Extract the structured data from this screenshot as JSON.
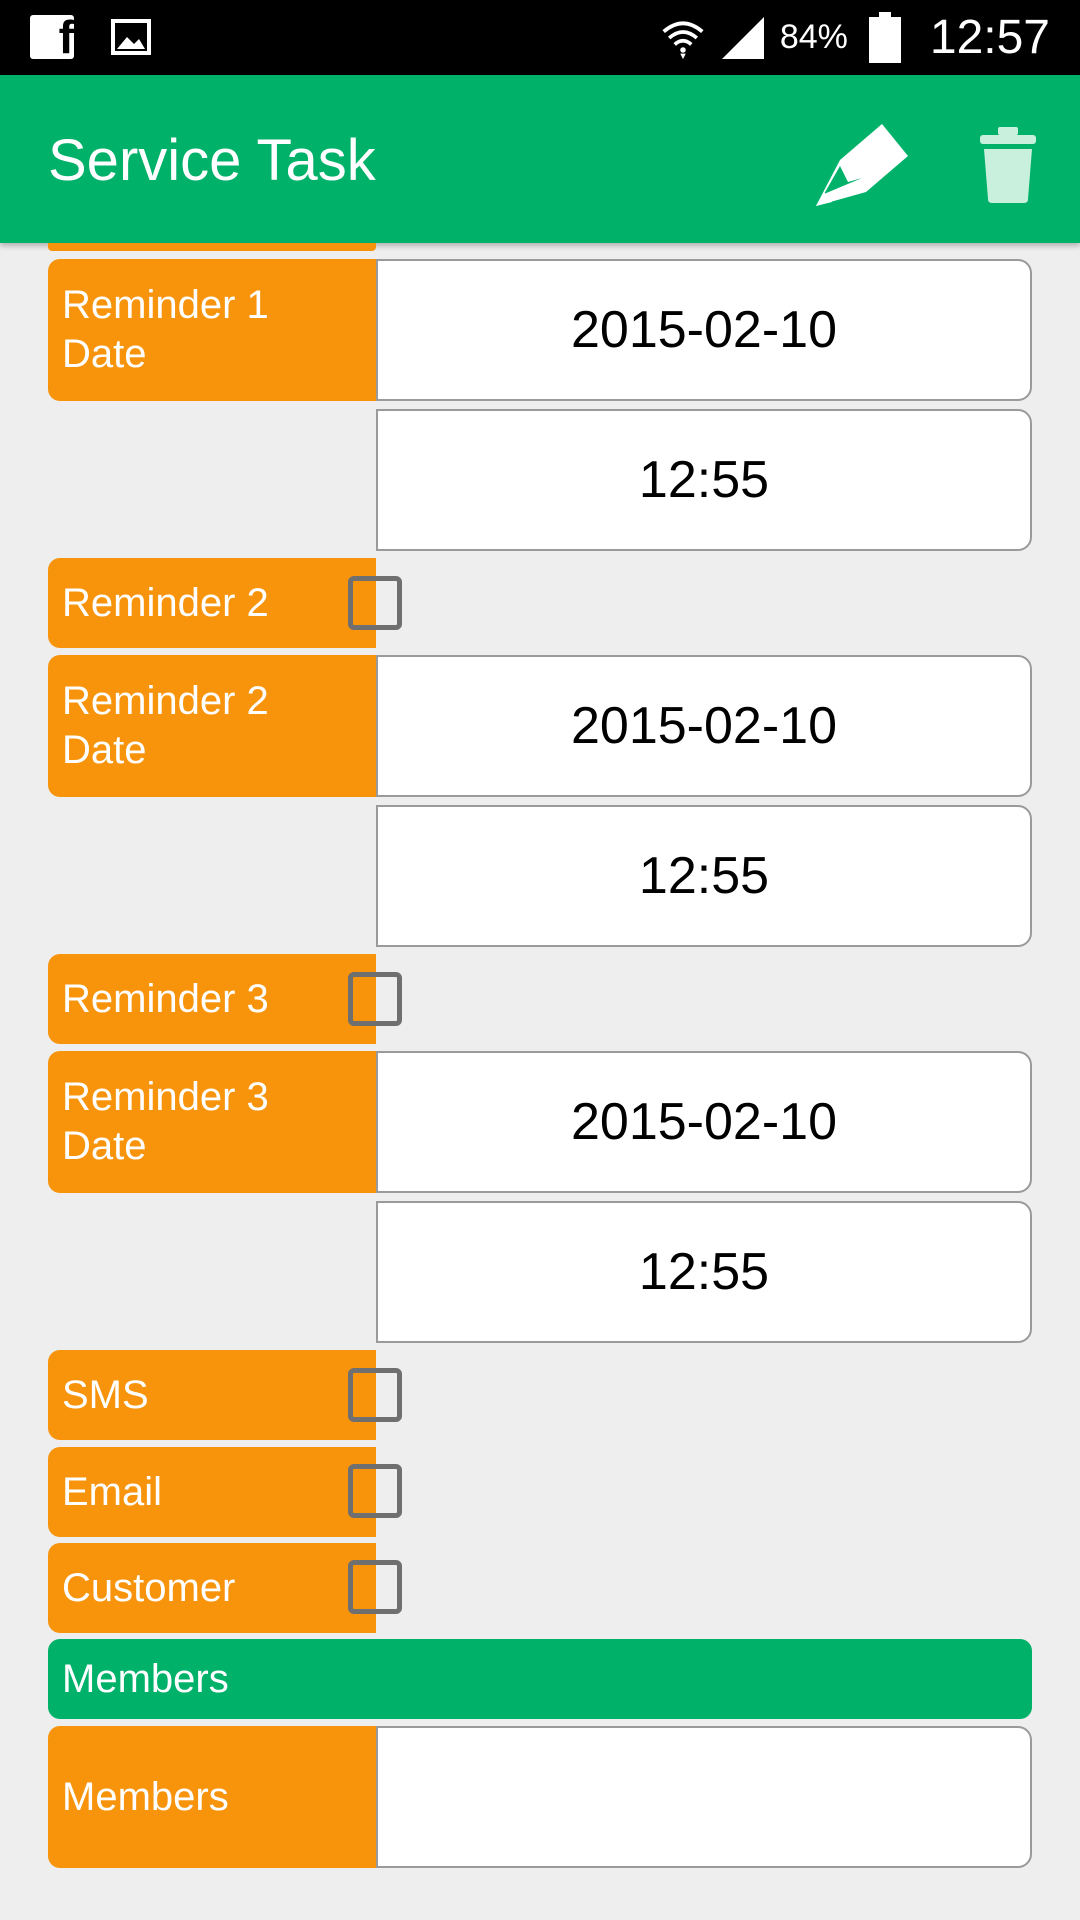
{
  "status_bar": {
    "icons_left": [
      "facebook-icon",
      "image-icon"
    ],
    "battery_percent": "84%",
    "clock": "12:57"
  },
  "app_bar": {
    "title": "Service Task",
    "actions": [
      "edit-icon",
      "trash-icon"
    ],
    "accent_color": "#00b16a"
  },
  "colors": {
    "label_bg": "#f7940c",
    "header_bg": "#00b16a",
    "page_bg": "#eeeeee"
  },
  "form": {
    "reminder1_date": {
      "label": "Reminder 1 Date",
      "date": "2015-02-10",
      "time": "12:55"
    },
    "reminder2": {
      "label": "Reminder 2",
      "checked": false
    },
    "reminder2_date": {
      "label": "Reminder 2 Date",
      "date": "2015-02-10",
      "time": "12:55"
    },
    "reminder3": {
      "label": "Reminder 3",
      "checked": false
    },
    "reminder3_date": {
      "label": "Reminder 3 Date",
      "date": "2015-02-10",
      "time": "12:55"
    },
    "sms": {
      "label": "SMS",
      "checked": false
    },
    "email": {
      "label": "Email",
      "checked": false
    },
    "customer": {
      "label": "Customer",
      "checked": false
    },
    "members_section": {
      "title": "Members"
    },
    "members": {
      "label": "Members",
      "value": ""
    }
  }
}
